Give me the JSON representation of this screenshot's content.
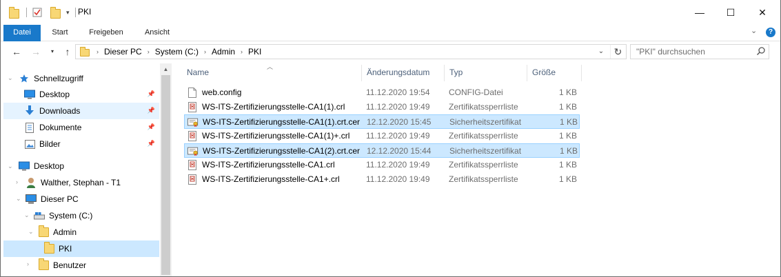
{
  "window": {
    "title": "PKI",
    "minimize": "—",
    "maximize": "☐",
    "close": "✕"
  },
  "ribbon": {
    "tabs": [
      "Datei",
      "Start",
      "Freigeben",
      "Ansicht"
    ],
    "collapse_glyph": "⌄",
    "help_glyph": "?"
  },
  "address": {
    "crumbs": [
      "Dieser PC",
      "System (C:)",
      "Admin",
      "PKI"
    ]
  },
  "search": {
    "placeholder": "\"PKI\" durchsuchen"
  },
  "nav": {
    "items": [
      {
        "label": "Schnellzugriff",
        "icon": "star-icon"
      },
      {
        "label": "Desktop",
        "icon": "desktop-icon"
      },
      {
        "label": "Downloads",
        "icon": "download-icon"
      },
      {
        "label": "Dokumente",
        "icon": "documents-icon"
      },
      {
        "label": "Bilder",
        "icon": "pictures-icon"
      },
      {
        "label": "Desktop",
        "icon": "desktop-icon"
      },
      {
        "label": "Walther, Stephan - T1",
        "icon": "user-icon"
      },
      {
        "label": "Dieser PC",
        "icon": "computer-icon"
      },
      {
        "label": "System (C:)",
        "icon": "drive-icon"
      },
      {
        "label": "Admin",
        "icon": "folder-icon"
      },
      {
        "label": "PKI",
        "icon": "folder-icon"
      },
      {
        "label": "Benutzer",
        "icon": "folder-icon"
      }
    ]
  },
  "columns": {
    "name": "Name",
    "date": "Änderungsdatum",
    "type": "Typ",
    "size": "Größe"
  },
  "files": [
    {
      "name": "web.config",
      "date": "11.12.2020 19:54",
      "type": "CONFIG-Datei",
      "size": "1 KB",
      "icon": "file-icon",
      "selected": false
    },
    {
      "name": "WS-ITS-Zertifizierungsstelle-CA1(1).crl",
      "date": "11.12.2020 19:49",
      "type": "Zertifikatssperrliste",
      "size": "1 KB",
      "icon": "crl-icon",
      "selected": false
    },
    {
      "name": "WS-ITS-Zertifizierungsstelle-CA1(1).crt.cer",
      "date": "12.12.2020 15:45",
      "type": "Sicherheitszertifikat",
      "size": "1 KB",
      "icon": "certificate-icon",
      "selected": true
    },
    {
      "name": "WS-ITS-Zertifizierungsstelle-CA1(1)+.crl",
      "date": "11.12.2020 19:49",
      "type": "Zertifikatssperrliste",
      "size": "1 KB",
      "icon": "crl-icon",
      "selected": false
    },
    {
      "name": "WS-ITS-Zertifizierungsstelle-CA1(2).crt.cer",
      "date": "12.12.2020 15:44",
      "type": "Sicherheitszertifikat",
      "size": "1 KB",
      "icon": "certificate-icon",
      "selected": true
    },
    {
      "name": "WS-ITS-Zertifizierungsstelle-CA1.crl",
      "date": "11.12.2020 19:49",
      "type": "Zertifikatssperrliste",
      "size": "1 KB",
      "icon": "crl-icon",
      "selected": false
    },
    {
      "name": "WS-ITS-Zertifizierungsstelle-CA1+.crl",
      "date": "11.12.2020 19:49",
      "type": "Zertifikatssperrliste",
      "size": "1 KB",
      "icon": "crl-icon",
      "selected": false
    }
  ]
}
